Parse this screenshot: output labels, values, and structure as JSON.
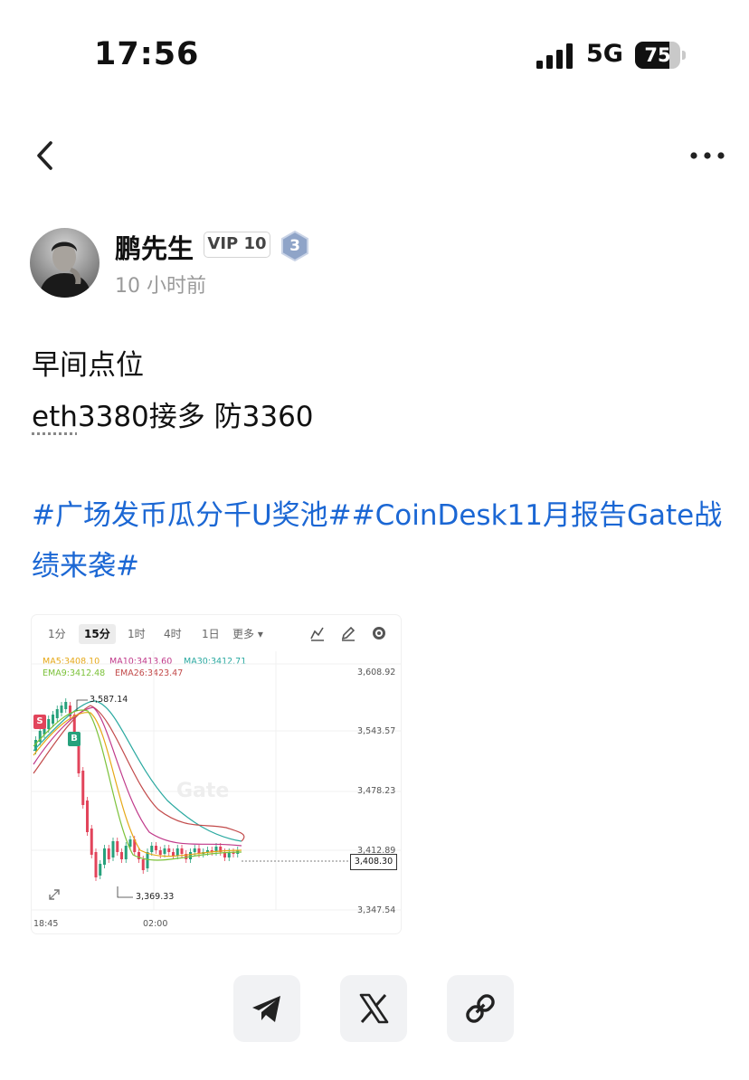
{
  "status_bar": {
    "time": "17:56",
    "network": "5G",
    "battery": "75",
    "battery_level": 0.75
  },
  "nav": {
    "back_icon": "chevron-left-icon",
    "more_icon": "more-horizontal-icon"
  },
  "author": {
    "name": "鹏先生",
    "vip": "VIP 10",
    "level": "3",
    "time": "10 小时前"
  },
  "post": {
    "line1": "早间点位",
    "line2_underlined": "eth",
    "line2_rest": "3380接多 防3360",
    "hashtags": "#广场发币瓜分千U奖池##CoinDesk11月报告Gate战绩来袭#"
  },
  "chart_image": {
    "timeframes": [
      "1分",
      "15分",
      "1时",
      "4时",
      "1日",
      "更多"
    ],
    "active_timeframe": "15分",
    "ma_labels": {
      "ma5": "MA5:3408.10",
      "ma10": "MA10:3413.60",
      "ma30": "MA30:3412.71",
      "ema9": "EMA9:3412.48",
      "ema26": "EMA26:3423.47"
    },
    "colors": {
      "ma5": "#e6a817",
      "ma10": "#c0398a",
      "ma30": "#2aa9a0",
      "ema9": "#7cc23a",
      "ema26": "#c24a4a",
      "up": "#27a17c",
      "down": "#e2445b"
    },
    "watermark": "Gate",
    "high_label": "3,587.14",
    "low_label": "3,369.33",
    "current_price": "3,408.30",
    "y_ticks": [
      "3,608.92",
      "3,543.57",
      "3,478.23",
      "3,412.89",
      "3,347.54"
    ],
    "x_ticks": [
      "18:45",
      "02:00"
    ],
    "sell_marker": "S",
    "buy_marker": "B"
  },
  "share": {
    "icons": [
      "telegram-icon",
      "x-icon",
      "link-icon"
    ]
  }
}
